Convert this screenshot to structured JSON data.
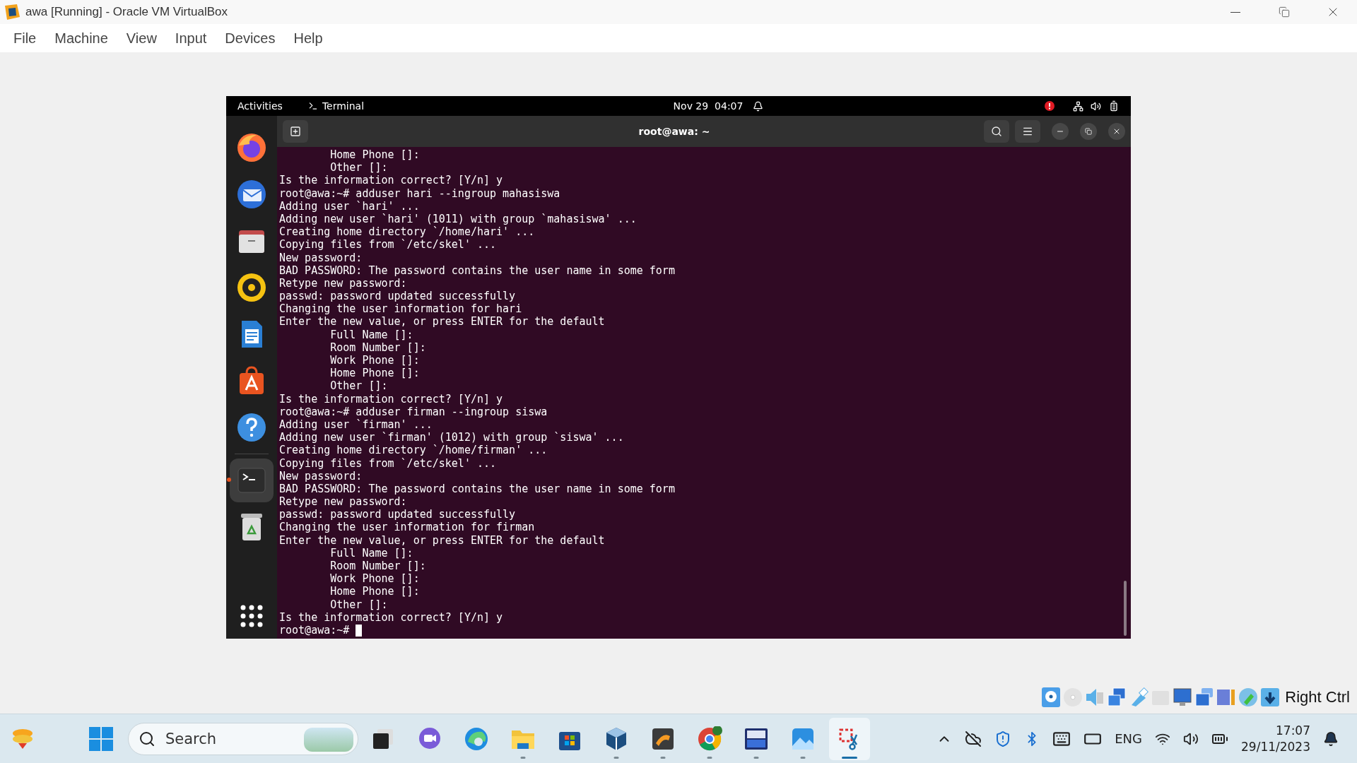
{
  "window": {
    "title": "awa [Running] - Oracle VM VirtualBox"
  },
  "menu": [
    "File",
    "Machine",
    "View",
    "Input",
    "Devices",
    "Help"
  ],
  "vm": {
    "topbar": {
      "activities": "Activities",
      "app": "Terminal",
      "clock": "Nov 29  04:07"
    },
    "dock": [
      {
        "kind": "firefox",
        "selected": false
      },
      {
        "kind": "mail",
        "selected": false
      },
      {
        "kind": "files",
        "selected": false
      },
      {
        "kind": "music",
        "selected": false
      },
      {
        "kind": "writer",
        "selected": false
      },
      {
        "kind": "software",
        "selected": false
      },
      {
        "kind": "help",
        "selected": false
      },
      {
        "kind": "terminal",
        "selected": true
      },
      {
        "kind": "trash",
        "selected": false
      }
    ],
    "terminal": {
      "title": "root@awa: ~",
      "lines": [
        "        Home Phone []:",
        "        Other []:",
        "Is the information correct? [Y/n] y",
        "root@awa:~# adduser hari --ingroup mahasiswa",
        "Adding user `hari' ...",
        "Adding new user `hari' (1011) with group `mahasiswa' ...",
        "Creating home directory `/home/hari' ...",
        "Copying files from `/etc/skel' ...",
        "New password:",
        "BAD PASSWORD: The password contains the user name in some form",
        "Retype new password:",
        "passwd: password updated successfully",
        "Changing the user information for hari",
        "Enter the new value, or press ENTER for the default",
        "        Full Name []:",
        "        Room Number []:",
        "        Work Phone []:",
        "        Home Phone []:",
        "        Other []:",
        "Is the information correct? [Y/n] y",
        "root@awa:~# adduser firman --ingroup siswa",
        "Adding user `firman' ...",
        "Adding new user `firman' (1012) with group `siswa' ...",
        "Creating home directory `/home/firman' ...",
        "Copying files from `/etc/skel' ...",
        "New password:",
        "BAD PASSWORD: The password contains the user name in some form",
        "Retype new password:",
        "passwd: password updated successfully",
        "Changing the user information for firman",
        "Enter the new value, or press ENTER for the default",
        "        Full Name []:",
        "        Room Number []:",
        "        Work Phone []:",
        "        Home Phone []:",
        "        Other []:",
        "Is the information correct? [Y/n] y"
      ],
      "prompt": "root@awa:~#"
    }
  },
  "status_bar": {
    "devices": [
      {
        "kind": "hard-disk"
      },
      {
        "kind": "optical"
      },
      {
        "kind": "audio"
      },
      {
        "kind": "network"
      },
      {
        "kind": "usb"
      },
      {
        "kind": "shared-folder"
      },
      {
        "kind": "display"
      },
      {
        "kind": "capture"
      },
      {
        "kind": "cpu"
      },
      {
        "kind": "mouse"
      },
      {
        "kind": "keyboard"
      }
    ],
    "host_key": "Right Ctrl"
  },
  "taskbar": {
    "search": {
      "placeholder": "Search"
    },
    "apps": [
      {
        "kind": "task-view",
        "running": false,
        "selected": false
      },
      {
        "kind": "chat",
        "running": false,
        "selected": false
      },
      {
        "kind": "browser",
        "running": false,
        "selected": false
      },
      {
        "kind": "folder",
        "running": true,
        "selected": false
      },
      {
        "kind": "store",
        "running": false,
        "selected": false
      },
      {
        "kind": "cube",
        "running": true,
        "selected": false
      },
      {
        "kind": "editor",
        "running": true,
        "selected": false
      },
      {
        "kind": "chrome",
        "running": true,
        "selected": false
      },
      {
        "kind": "ide",
        "running": true,
        "selected": false
      },
      {
        "kind": "photos",
        "running": true,
        "selected": false
      },
      {
        "kind": "snip",
        "running": true,
        "selected": true
      }
    ],
    "tray": {
      "language": "ENG",
      "time": "17:07",
      "date": "29/11/2023"
    }
  }
}
